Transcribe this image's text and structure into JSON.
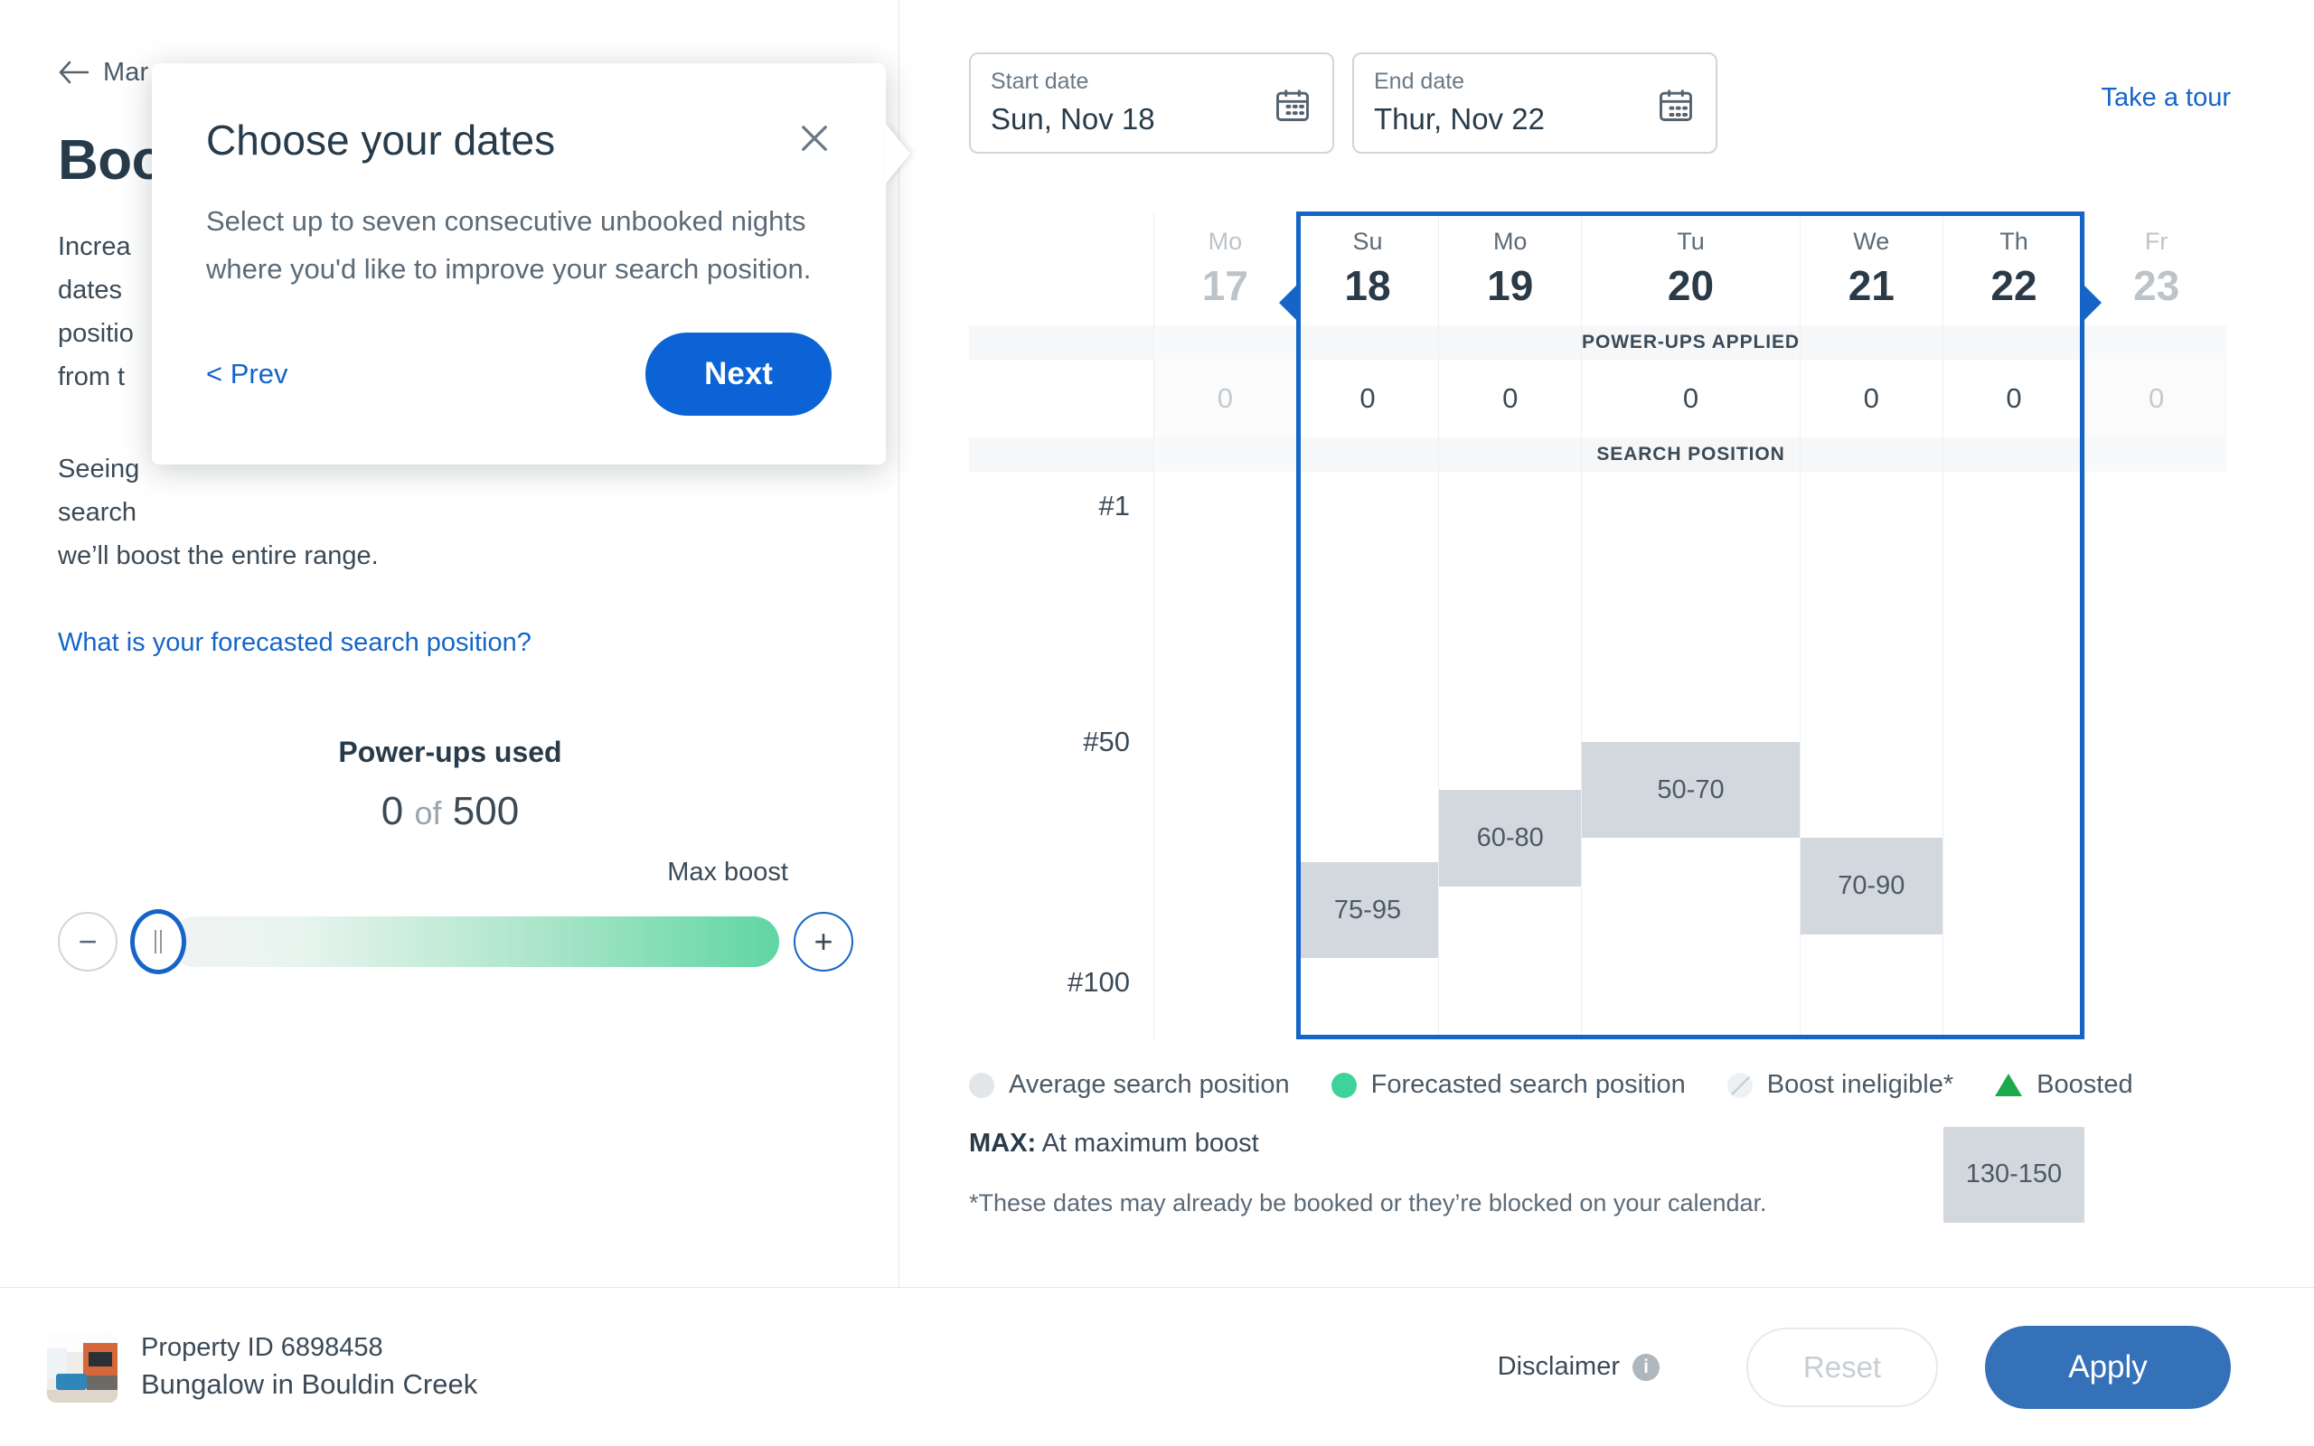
{
  "nav": {
    "back_icon": "arrow-left-icon",
    "back_label": "Mar"
  },
  "page": {
    "title": "Boo",
    "paragraph_1": "Increa    \ndates     \npositio    \nfrom t    ",
    "paragraph_1_lines": [
      "Increa",
      "dates",
      "positio",
      "from t"
    ],
    "paragraph_2_lines": [
      "Seeing",
      "search",
      "we’ll boost the entire range."
    ],
    "forecast_link": "What is your forecasted search position?"
  },
  "powerups": {
    "title": "Power-ups used",
    "used": "0",
    "of_word": "of",
    "total": "500",
    "max_boost_label": "Max boost",
    "minus_icon": "minus-icon",
    "plus_icon": "plus-icon",
    "thumb_icon": "slider-thumb-grip-icon"
  },
  "dates": {
    "start": {
      "label": "Start date",
      "value": "Sun, Nov 18",
      "icon": "calendar-start-icon"
    },
    "end": {
      "label": "End date",
      "value": "Thur, Nov 22",
      "icon": "calendar-end-icon"
    },
    "take_a_tour": "Take a tour"
  },
  "chart_data": {
    "type": "bar",
    "title": "",
    "xlabel": "",
    "ylabel": "Search position",
    "ylim": [
      1,
      150
    ],
    "ytick_labels": [
      "#1",
      "#50",
      "#100"
    ],
    "ytick_values": [
      1,
      50,
      100
    ],
    "grid": true,
    "legend_position": "bottom",
    "band_labels": {
      "powerups": "POWER-UPS APPLIED",
      "position": "SEARCH POSITION"
    },
    "categories": [
      {
        "dow": "Mo",
        "day": "17",
        "selected": false,
        "powerups": "0",
        "range": null,
        "range_low": null,
        "range_high": null
      },
      {
        "dow": "Su",
        "day": "18",
        "selected": true,
        "powerups": "0",
        "range": "75-95",
        "range_low": 75,
        "range_high": 95
      },
      {
        "dow": "Mo",
        "day": "19",
        "selected": true,
        "powerups": "0",
        "range": "60-80",
        "range_low": 60,
        "range_high": 80
      },
      {
        "dow": "Tu",
        "day": "20",
        "selected": true,
        "powerups": "0",
        "range": "50-70",
        "range_low": 50,
        "range_high": 70
      },
      {
        "dow": "We",
        "day": "21",
        "selected": true,
        "powerups": "0",
        "range": "70-90",
        "range_low": 70,
        "range_high": 90
      },
      {
        "dow": "Th",
        "day": "22",
        "selected": true,
        "powerups": "0",
        "range": "130-150",
        "range_low": 130,
        "range_high": 150
      },
      {
        "dow": "Fr",
        "day": "23",
        "selected": false,
        "powerups": "0",
        "range": null,
        "range_low": null,
        "range_high": null
      }
    ],
    "legend": [
      {
        "label": "Average search position",
        "marker": "grey-dot-icon",
        "color": "#e2e6e9"
      },
      {
        "label": "Forecasted search position",
        "marker": "green-dot-icon",
        "color": "#3ed39a"
      },
      {
        "label": "Boost ineligible*",
        "marker": "hatched-dot-icon",
        "color": "#eef1f3"
      },
      {
        "label": "Boosted",
        "marker": "green-triangle-icon",
        "color": "#1ba94c"
      }
    ],
    "annotations": {
      "max_key": "MAX:",
      "max_text": "At maximum boost",
      "footnote": "*These dates may already be booked or they’re blocked on your calendar."
    }
  },
  "tour_popup": {
    "title": "Choose your dates",
    "description": "Select up to seven consecutive unbooked nights where you'd like to improve your search position.",
    "prev_label": "< Prev",
    "next_label": "Next",
    "close_icon": "close-icon"
  },
  "footer": {
    "property_id": "Property ID 6898458",
    "property_name": "Bungalow in Bouldin Creek",
    "disclaimer_label": "Disclaimer",
    "disclaimer_icon": "info-icon",
    "reset_label": "Reset",
    "apply_label": "Apply",
    "thumbnail_icon": "property-thumbnail"
  },
  "colors": {
    "accent_blue": "#1565c8",
    "next_blue": "#0b63d6",
    "apply_blue": "#3571b8",
    "bar_grey": "#d3d8de",
    "green": "#3ed39a"
  }
}
